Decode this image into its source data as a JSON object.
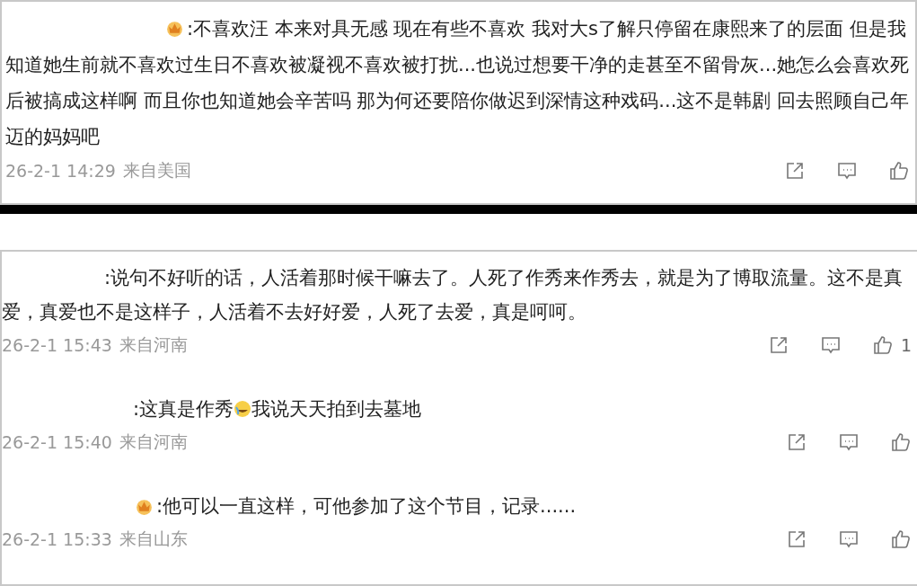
{
  "panels": [
    {
      "comments": [
        {
          "badge": true,
          "parts": [
            {
              "kind": "text",
              "text": ":不喜欢汪 本来对具无感 现在有些不喜欢 我对大s了解只停留在康熙来了的层面 但是我知道她生前就不喜欢过生日不喜欢被凝视不喜欢被打扰...也说过想要干净的走甚至不留骨灰...她怎么会喜欢死后被搞成这样啊 而且你也知道她会辛苦吗 那为何还要陪你做迟到深情这种戏码...这不是韩剧 回去照顾自己年迈的妈妈吧"
            }
          ],
          "time": "26-2-1 14:29",
          "location": "来自美国"
        }
      ]
    },
    {
      "comments": [
        {
          "badge": false,
          "parts": [
            {
              "kind": "text",
              "text": ":说句不好听的话，人活着那时候干嘛去了。人死了作秀来作秀去，就是为了博取流量。这不是真爱，真爱也不是这样子，人活着不去好好爱，人死了去爱，真是呵呵。"
            }
          ],
          "time": "26-2-1 15:43",
          "location": "来自河南",
          "likes": "1"
        },
        {
          "badge": false,
          "parts": [
            {
              "kind": "text",
              "text": ":这真是作秀"
            },
            {
              "kind": "emoji"
            },
            {
              "kind": "text",
              "text": "我说天天拍到去墓地"
            }
          ],
          "time": "26-2-1 15:40",
          "location": "来自河南"
        },
        {
          "badge": true,
          "parts": [
            {
              "kind": "text",
              "text": ":他可以一直这样，可他参加了这个节目，记录......"
            }
          ],
          "time": "26-2-1 15:33",
          "location": "来自山东"
        }
      ]
    }
  ]
}
